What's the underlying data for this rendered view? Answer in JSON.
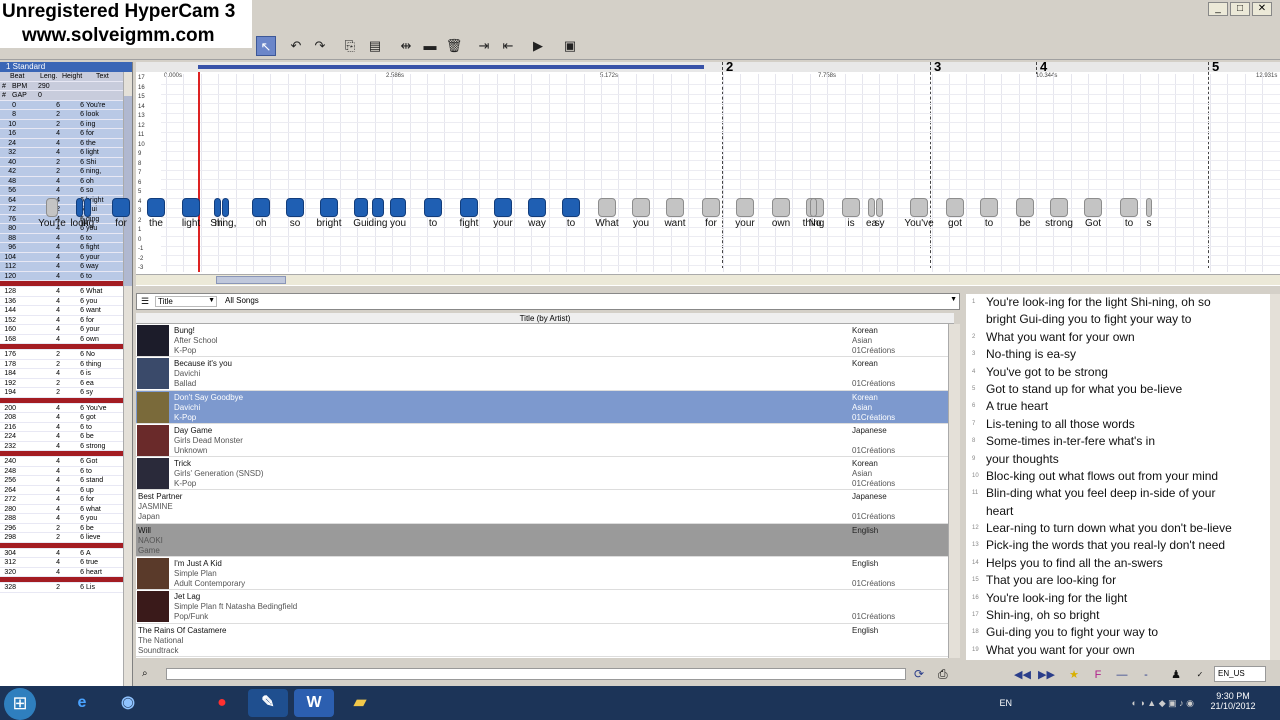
{
  "watermark": {
    "line1": "Unregistered HyperCam 3",
    "line2": "www.solveigmm.com"
  },
  "window_controls": [
    "_",
    "□",
    "✕"
  ],
  "left_panel": {
    "tab": "1 Standard",
    "headers": [
      "Beat",
      "Leng.",
      "Height",
      "Text"
    ],
    "meta": [
      [
        "#",
        "BPM",
        "290"
      ],
      [
        "#",
        "GAP",
        "0"
      ]
    ],
    "rows": [
      [
        "0",
        "6",
        "6",
        "You're"
      ],
      [
        "8",
        "2",
        "6",
        "look"
      ],
      [
        "10",
        "2",
        "6",
        "ing"
      ],
      [
        "16",
        "4",
        "6",
        "for"
      ],
      [
        "24",
        "4",
        "6",
        "the"
      ],
      [
        "32",
        "4",
        "6",
        "light"
      ],
      [
        "40",
        "2",
        "6",
        "Shi"
      ],
      [
        "42",
        "2",
        "6",
        "ning,"
      ],
      [
        "48",
        "4",
        "6",
        "oh"
      ],
      [
        "56",
        "4",
        "6",
        "so"
      ],
      [
        "64",
        "4",
        "6",
        "bright"
      ],
      [
        "72",
        "2",
        "6",
        "Gui"
      ],
      [
        "76",
        "4",
        "6",
        "ding"
      ],
      [
        "80",
        "4",
        "6",
        "you"
      ],
      [
        "88",
        "4",
        "6",
        "to"
      ],
      [
        "96",
        "4",
        "6",
        "fight"
      ],
      [
        "104",
        "4",
        "6",
        "your"
      ],
      [
        "112",
        "4",
        "6",
        "way"
      ],
      [
        "120",
        "4",
        "6",
        "to"
      ],
      "-",
      [
        "128",
        "4",
        "6",
        "What"
      ],
      [
        "136",
        "4",
        "6",
        "you"
      ],
      [
        "144",
        "4",
        "6",
        "want"
      ],
      [
        "152",
        "4",
        "6",
        "for"
      ],
      [
        "160",
        "4",
        "6",
        "your"
      ],
      [
        "168",
        "4",
        "6",
        "own"
      ],
      "-",
      [
        "176",
        "2",
        "6",
        "No"
      ],
      [
        "178",
        "2",
        "6",
        "thing"
      ],
      [
        "184",
        "4",
        "6",
        "is"
      ],
      [
        "192",
        "2",
        "6",
        "ea"
      ],
      [
        "194",
        "2",
        "6",
        "sy"
      ],
      "-",
      [
        "200",
        "4",
        "6",
        "You've"
      ],
      [
        "208",
        "4",
        "6",
        "got"
      ],
      [
        "216",
        "4",
        "6",
        "to"
      ],
      [
        "224",
        "4",
        "6",
        "be"
      ],
      [
        "232",
        "4",
        "6",
        "strong"
      ],
      "-",
      [
        "240",
        "4",
        "6",
        "Got"
      ],
      [
        "248",
        "4",
        "6",
        "to"
      ],
      [
        "256",
        "4",
        "6",
        "stand"
      ],
      [
        "264",
        "4",
        "6",
        "up"
      ],
      [
        "272",
        "4",
        "6",
        "for"
      ],
      [
        "280",
        "4",
        "6",
        "what"
      ],
      [
        "288",
        "4",
        "6",
        "you"
      ],
      [
        "296",
        "2",
        "6",
        "be"
      ],
      [
        "298",
        "2",
        "6",
        "lieve"
      ],
      "-",
      [
        "304",
        "4",
        "6",
        "A"
      ],
      [
        "312",
        "4",
        "6",
        "true"
      ],
      [
        "320",
        "4",
        "6",
        "heart"
      ],
      "-",
      [
        "328",
        "2",
        "6",
        "Lis"
      ]
    ]
  },
  "editor": {
    "time_labels": [
      "0.000s",
      "2.586s",
      "5.172s",
      "7.758s",
      "10.344s",
      "12.931s"
    ],
    "beat_numbers": [
      "2",
      "3",
      "4",
      "5"
    ],
    "pitch_labels": [
      "17",
      "16",
      "15",
      "14",
      "13",
      "12",
      "11",
      "10",
      "9",
      "8",
      "7",
      "6",
      "5",
      "4",
      "3",
      "2",
      "1",
      "0",
      "-1",
      "-2",
      "-3"
    ],
    "notes": [
      {
        "text": "You're",
        "c": "g"
      },
      {
        "text": "look",
        "c": "b"
      },
      {
        "text": "ing",
        "c": "b"
      },
      {
        "text": "for",
        "c": "b"
      },
      {
        "text": "the",
        "c": "b"
      },
      {
        "text": "light",
        "c": "b"
      },
      {
        "text": "Shi",
        "c": "b"
      },
      {
        "text": "ning,",
        "c": "b"
      },
      {
        "text": "oh",
        "c": "b"
      },
      {
        "text": "so",
        "c": "b"
      },
      {
        "text": "bright",
        "c": "b"
      },
      {
        "text": "Gui",
        "c": "b"
      },
      {
        "text": "ding",
        "c": "b"
      },
      {
        "text": "you",
        "c": "b"
      },
      {
        "text": "to",
        "c": "b"
      },
      {
        "text": "fight",
        "c": "b"
      },
      {
        "text": "your",
        "c": "b"
      },
      {
        "text": "way",
        "c": "b"
      },
      {
        "text": "to",
        "c": "b"
      },
      {
        "text": "What",
        "c": "g"
      },
      {
        "text": "you",
        "c": "g"
      },
      {
        "text": "want",
        "c": "g"
      },
      {
        "text": "for",
        "c": "g"
      },
      {
        "text": "your",
        "c": "g"
      },
      {
        "text": "own",
        "c": "g"
      },
      {
        "text": "No",
        "c": "g"
      },
      {
        "text": "thing",
        "c": "g"
      },
      {
        "text": "is",
        "c": "g"
      },
      {
        "text": "ea",
        "c": "g"
      },
      {
        "text": "sy",
        "c": "g"
      },
      {
        "text": "You've",
        "c": "g"
      },
      {
        "text": "got",
        "c": "g"
      },
      {
        "text": "to",
        "c": "g"
      },
      {
        "text": "be",
        "c": "g"
      },
      {
        "text": "strong",
        "c": "g"
      },
      {
        "text": "Got",
        "c": "g"
      },
      {
        "text": "to",
        "c": "g"
      },
      {
        "text": "s",
        "c": "g"
      }
    ]
  },
  "filter": {
    "field": "Title",
    "value": "All Songs",
    "column_header": "Title (by Artist)"
  },
  "songs": [
    {
      "title": "Bung!",
      "artist": "After School",
      "genre": "K-Pop",
      "lang": "Korean",
      "region": "Asian",
      "creator": "01Créations",
      "cover": true,
      "state": ""
    },
    {
      "title": "Because it's you",
      "artist": "Davichi",
      "genre": "Ballad",
      "lang": "Korean",
      "region": "",
      "creator": "01Créations",
      "cover": true,
      "state": ""
    },
    {
      "title": "Don't Say Goodbye",
      "artist": "Davichi",
      "genre": "K-Pop",
      "lang": "Korean",
      "region": "Asian",
      "creator": "01Créations",
      "cover": true,
      "state": "sel"
    },
    {
      "title": "Day Game",
      "artist": "Girls Dead Monster",
      "genre": "Unknown",
      "lang": "Japanese",
      "region": "",
      "creator": "01Créations",
      "cover": true,
      "state": ""
    },
    {
      "title": "Trick",
      "artist": "Girls' Generation (SNSD)",
      "genre": "K-Pop",
      "lang": "Korean",
      "region": "Asian",
      "creator": "01Créations",
      "cover": true,
      "state": ""
    },
    {
      "title": "Best Partner",
      "artist": "JASMINE",
      "genre": "Japan",
      "lang": "Japanese",
      "region": "",
      "creator": "01Créations",
      "cover": false,
      "state": ""
    },
    {
      "title": "Will",
      "artist": "NAOKI",
      "genre": "Game",
      "lang": "English",
      "region": "",
      "creator": "",
      "cover": false,
      "state": "dark"
    },
    {
      "title": "I'm Just A Kid",
      "artist": "Simple Plan",
      "genre": "Adult Contemporary",
      "lang": "English",
      "region": "",
      "creator": "01Créations",
      "cover": true,
      "state": ""
    },
    {
      "title": "Jet Lag",
      "artist": "Simple Plan ft Natasha Bedingfield",
      "genre": "Pop/Funk",
      "lang": "",
      "region": "",
      "creator": "01Créations",
      "cover": true,
      "state": ""
    },
    {
      "title": "The Rains Of Castamere",
      "artist": "The National",
      "genre": "Soundtrack",
      "lang": "English",
      "region": "",
      "creator": "",
      "cover": false,
      "state": ""
    }
  ],
  "lyrics": [
    {
      "n": "1",
      "text": "You're look-ing for the light Shi-ning, oh so"
    },
    {
      "n": "",
      "text": "bright Gui-ding you to fight your way to"
    },
    {
      "n": "2",
      "text": "What you want for your own"
    },
    {
      "n": "3",
      "text": "No-thing is ea-sy"
    },
    {
      "n": "4",
      "text": "You've got to be strong"
    },
    {
      "n": "5",
      "text": "Got to stand up for what you be-lieve"
    },
    {
      "n": "6",
      "text": "A true heart"
    },
    {
      "n": "7",
      "text": "Lis-tening to all those words"
    },
    {
      "n": "8",
      "text": "Some-times in-ter-fere what's in"
    },
    {
      "n": "9",
      "text": "your thoughts"
    },
    {
      "n": "10",
      "text": "Bloc-king out what flows out from your mind"
    },
    {
      "n": "11",
      "text": "Blin-ding what you feel deep in-side of your"
    },
    {
      "n": "",
      "text": "heart"
    },
    {
      "n": "12",
      "text": "Lear-ning to turn down what you don't be-lieve"
    },
    {
      "n": "13",
      "text": "Pick-ing the words that you real-ly don't need"
    },
    {
      "n": "14",
      "text": "Helps you to find all the an-swers"
    },
    {
      "n": "15",
      "text": "That you are loo-king for"
    },
    {
      "n": "16",
      "text": "You're look-ing for the light"
    },
    {
      "n": "17",
      "text": "Shin-ing, oh so bright"
    },
    {
      "n": "18",
      "text": "Gui-ding you to fight your way to"
    },
    {
      "n": "19",
      "text": "What you want for your own"
    }
  ],
  "lyrics_lang": "EN_US",
  "tray": {
    "lang": "EN",
    "time": "9:30 PM",
    "date": "21/10/2012"
  }
}
